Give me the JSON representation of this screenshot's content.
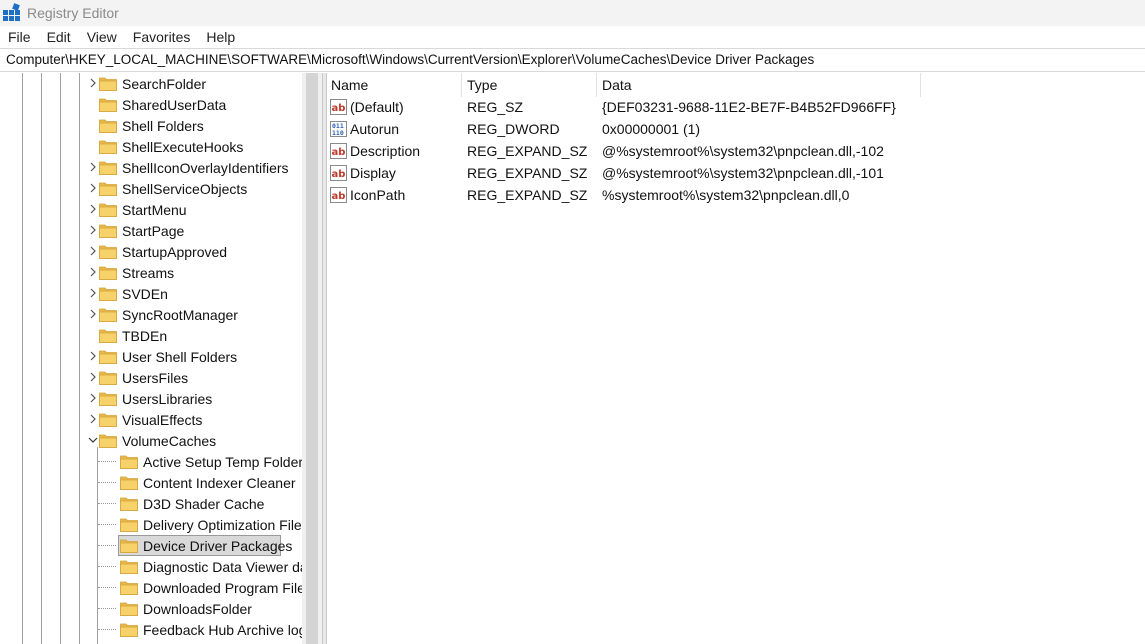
{
  "window": {
    "title": "Registry Editor"
  },
  "menu": {
    "items": [
      "File",
      "Edit",
      "View",
      "Favorites",
      "Help"
    ]
  },
  "address": {
    "path": "Computer\\HKEY_LOCAL_MACHINE\\SOFTWARE\\Microsoft\\Windows\\CurrentVersion\\Explorer\\VolumeCaches\\Device Driver Packages"
  },
  "tree": {
    "parent_items": [
      {
        "label": "SearchFolder",
        "expander": "collapsed"
      },
      {
        "label": "SharedUserData",
        "expander": "none"
      },
      {
        "label": "Shell Folders",
        "expander": "none"
      },
      {
        "label": "ShellExecuteHooks",
        "expander": "none"
      },
      {
        "label": "ShellIconOverlayIdentifiers",
        "expander": "collapsed"
      },
      {
        "label": "ShellServiceObjects",
        "expander": "collapsed"
      },
      {
        "label": "StartMenu",
        "expander": "collapsed"
      },
      {
        "label": "StartPage",
        "expander": "collapsed"
      },
      {
        "label": "StartupApproved",
        "expander": "collapsed"
      },
      {
        "label": "Streams",
        "expander": "collapsed"
      },
      {
        "label": "SVDEn",
        "expander": "collapsed"
      },
      {
        "label": "SyncRootManager",
        "expander": "collapsed"
      },
      {
        "label": "TBDEn",
        "expander": "none"
      },
      {
        "label": "User Shell Folders",
        "expander": "collapsed"
      },
      {
        "label": "UsersFiles",
        "expander": "collapsed"
      },
      {
        "label": "UsersLibraries",
        "expander": "collapsed"
      },
      {
        "label": "VisualEffects",
        "expander": "collapsed"
      },
      {
        "label": "VolumeCaches",
        "expander": "expanded"
      }
    ],
    "child_items": [
      {
        "label": "Active Setup Temp Folders",
        "selected": false
      },
      {
        "label": "Content Indexer Cleaner",
        "selected": false
      },
      {
        "label": "D3D Shader Cache",
        "selected": false
      },
      {
        "label": "Delivery Optimization Files",
        "selected": false
      },
      {
        "label": "Device Driver Packages",
        "selected": true
      },
      {
        "label": "Diagnostic Data Viewer da",
        "selected": false
      },
      {
        "label": "Downloaded Program Files",
        "selected": false
      },
      {
        "label": "DownloadsFolder",
        "selected": false
      },
      {
        "label": "Feedback Hub Archive log",
        "selected": false
      }
    ]
  },
  "values": {
    "columns": {
      "name": "Name",
      "type": "Type",
      "data": "Data"
    },
    "rows": [
      {
        "name": "(Default)",
        "type": "REG_SZ",
        "data": "{DEF03231-9688-11E2-BE7F-B4B52FD966FF}",
        "icon": "string-value-icon"
      },
      {
        "name": "Autorun",
        "type": "REG_DWORD",
        "data": "0x00000001 (1)",
        "icon": "binary-value-icon"
      },
      {
        "name": "Description",
        "type": "REG_EXPAND_SZ",
        "data": "@%systemroot%\\system32\\pnpclean.dll,-102",
        "icon": "string-value-icon"
      },
      {
        "name": "Display",
        "type": "REG_EXPAND_SZ",
        "data": "@%systemroot%\\system32\\pnpclean.dll,-101",
        "icon": "string-value-icon"
      },
      {
        "name": "IconPath",
        "type": "REG_EXPAND_SZ",
        "data": "%systemroot%\\system32\\pnpclean.dll,0",
        "icon": "string-value-icon"
      }
    ]
  },
  "colors": {
    "folder_fill": "#f7d26b",
    "folder_tab": "#e8b84a",
    "app_icon_blue": "#1f6fc5",
    "string_icon_red": "#c0392b",
    "binary_icon_blue": "#2b5fb3"
  }
}
